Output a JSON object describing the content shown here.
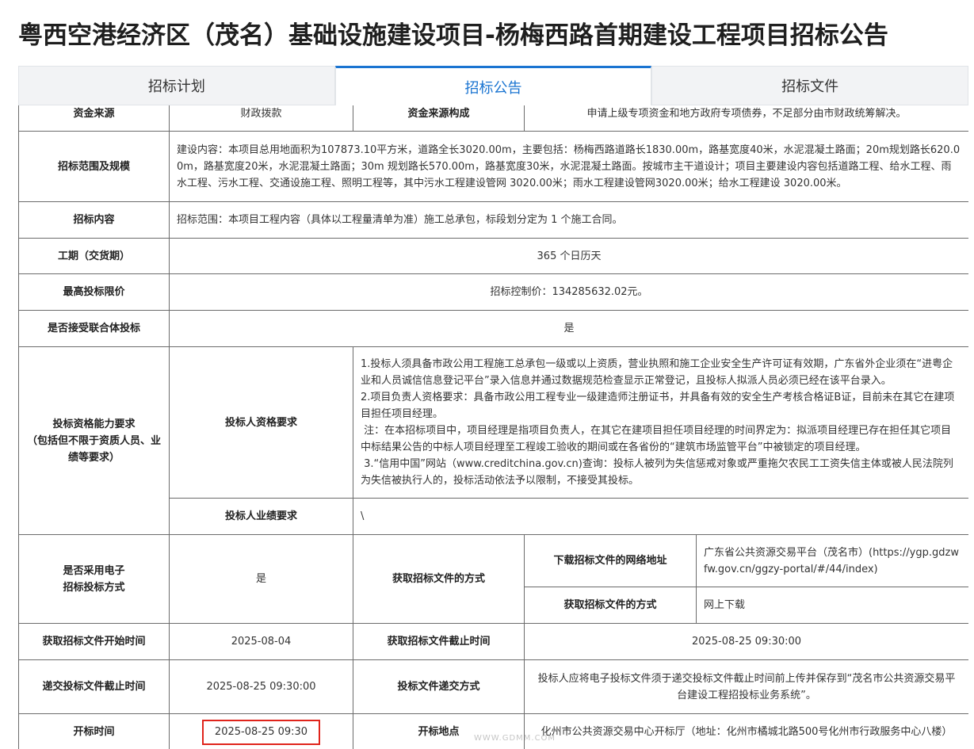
{
  "page": {
    "title": "粤西空港经济区（茂名）基础设施建设项目-杨梅西路首期建设工程项目招标公告"
  },
  "tabs": [
    {
      "label": "招标计划",
      "active": false
    },
    {
      "label": "招标公告",
      "active": true
    },
    {
      "label": "招标文件",
      "active": false
    }
  ],
  "table": {
    "fund_source": {
      "label": "资金来源",
      "value": "财政拨款",
      "composition_label": "资金来源构成",
      "composition_value": "申请上级专项资金和地方政府专项债券，不足部分由市财政统筹解决。"
    },
    "scope": {
      "label": "招标范围及规模",
      "value": "建设内容：本项目总用地面积为107873.10平方米，道路全长3020.00m，主要包括：杨梅西路道路长1830.00m，路基宽度40米，水泥混凝土路面；20m规划路长620.00m，路基宽度20米，水泥混凝土路面；30m 规划路长570.00m，路基宽度30米，水泥混凝土路面。按城市主干道设计；项目主要建设内容包括道路工程、给水工程、雨水工程、污水工程、交通设施工程、照明工程等，其中污水工程建设管网 3020.00米；雨水工程建设管网3020.00米；给水工程建设 3020.00米。"
    },
    "content": {
      "label": "招标内容",
      "value": "招标范围：本项目工程内容（具体以工程量清单为准）施工总承包，标段划分定为 1 个施工合同。"
    },
    "duration": {
      "label": "工期（交货期）",
      "value": "365 个日历天"
    },
    "max_price": {
      "label": "最高投标限价",
      "value": "招标控制价：134285632.02元。"
    },
    "consortium": {
      "label": "是否接受联合体投标",
      "value": "是"
    },
    "qualification": {
      "label": "投标资格能力要求",
      "label_note": "（包括但不限于资质人员、业绩等要求）",
      "bidder_label": "投标人资格要求",
      "bidder_items": [
        "1.投标人须具备市政公用工程施工总承包一级或以上资质，营业执照和施工企业安全生产许可证有效期，广东省外企业须在“进粤企业和人员诚信信息登记平台”录入信息并通过数据规范检查显示正常登记，且投标人拟派人员必须已经在该平台录入。",
        "2.项目负责人资格要求：具备市政公用工程专业一级建造师注册证书，并具备有效的安全生产考核合格证B证，目前未在其它在建项目担任项目经理。",
        " 注：在本招标项目中，项目经理是指项目负责人，在其它在建项目担任项目经理的时间界定为：拟派项目经理已存在担任其它项目中标结果公告的中标人项目经理至工程竣工验收的期间或在各省份的“建筑市场监管平台”中被锁定的项目经理。",
        " 3.“信用中国”网站（www.creditchina.gov.cn)查询：投标人被列为失信惩戒对象或严重拖欠农民工工资失信主体或被人民法院列为失信被执行人的，投标活动依法予以限制，不接受其投标。"
      ],
      "performance_label": "投标人业绩要求",
      "performance_value": "\\"
    },
    "electronic": {
      "label": "是否采用电子招标投标方式",
      "value": "是",
      "obtain_label": "获取招标文件的方式",
      "download_url_label": "下载招标文件的网络地址",
      "download_url_value": "广东省公共资源交易平台（茂名市）(https://ygp.gdzwfw.gov.cn/ggzy-portal/#/44/index)",
      "obtain_method_label": "获取招标文件的方式",
      "obtain_method_value": "网上下载"
    },
    "obtain_time": {
      "start_label": "获取招标文件开始时间",
      "start_value": "2025-08-04",
      "end_label": "获取招标文件截止时间",
      "end_value": "2025-08-25 09:30:00"
    },
    "submission": {
      "deadline_label": "递交投标文件截止时间",
      "deadline_value": "2025-08-25 09:30:00",
      "method_label": "投标文件递交方式",
      "method_value": "投标人应将电子投标文件须于递交投标文件截止时间前上传并保存到“茂名市公共资源交易平台建设工程招投标业务系统”。"
    },
    "opening": {
      "time_label": "开标时间",
      "time_value": "2025-08-25 09:30",
      "place_label": "开标地点",
      "place_value": "化州市公共资源交易中心开标厅（地址：化州市橘城北路500号化州市行政服务中心八楼）"
    }
  },
  "colors": {
    "accent": "#1a74d1",
    "highlight_box": "#e0241b",
    "border": "#6b6b6b"
  },
  "watermark": "WWW.GDMM.COM"
}
